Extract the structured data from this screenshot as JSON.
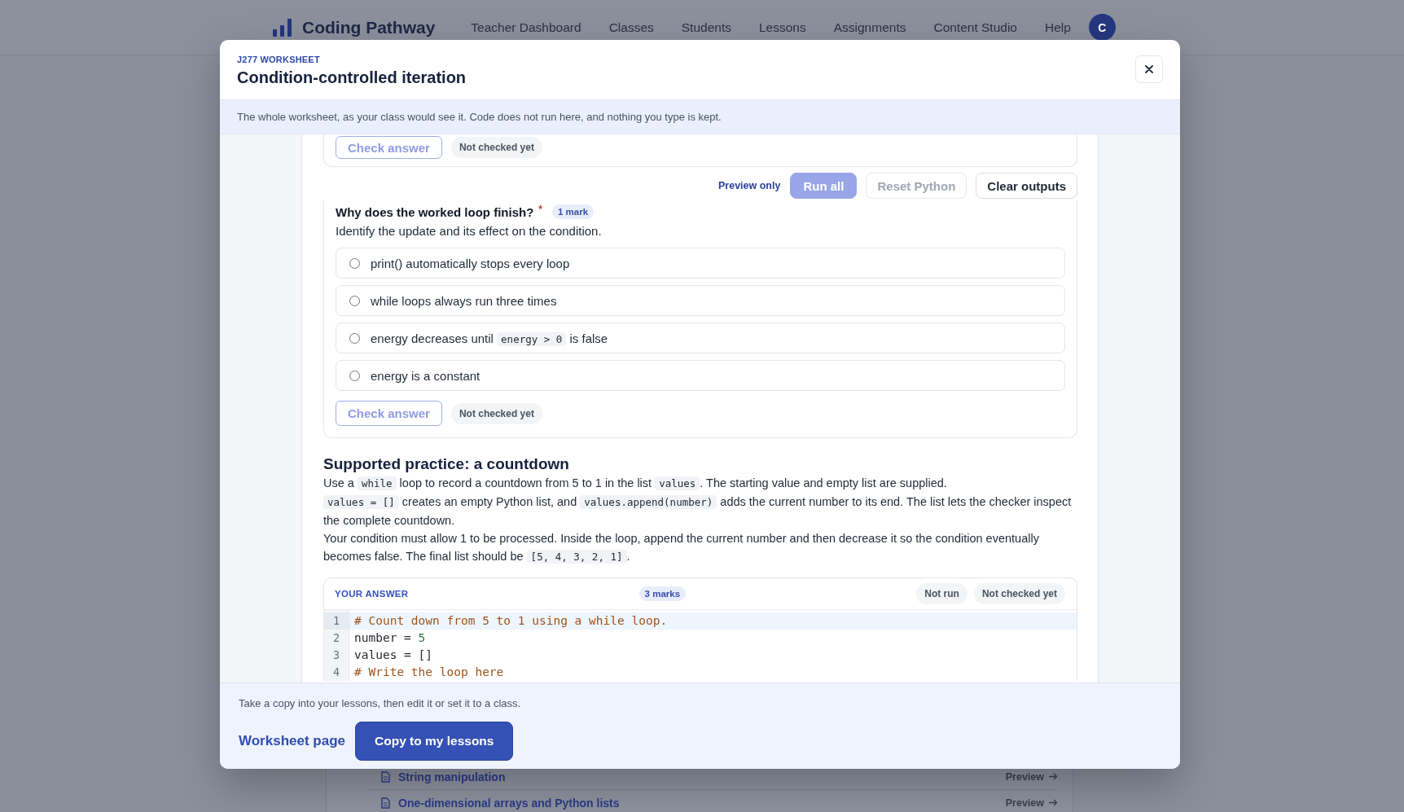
{
  "nav": {
    "brand": "Coding Pathway",
    "links": [
      {
        "label": "Teacher Dashboard"
      },
      {
        "label": "Classes"
      },
      {
        "label": "Students"
      },
      {
        "label": "Lessons"
      },
      {
        "label": "Assignments"
      },
      {
        "label": "Content Studio"
      },
      {
        "label": "Help"
      }
    ],
    "avatar": "C"
  },
  "modal": {
    "eyebrow": "J277 WORKSHEET",
    "title": "Condition-controlled iteration",
    "notice": "The whole worksheet, as your class would see it. Code does not run here, and nothing you type is kept.",
    "previous_question": {
      "check_button": {
        "label": "Check answer",
        "disabled": true
      },
      "status": "Not checked yet"
    },
    "toolbar": {
      "note": "Preview only",
      "buttons": [
        {
          "label": "Run all",
          "kind": "primary",
          "disabled": true
        },
        {
          "label": "Reset Python",
          "kind": "secondary",
          "disabled": true
        },
        {
          "label": "Clear outputs",
          "kind": "secondary",
          "disabled": false
        }
      ]
    },
    "question": {
      "title": "Why does the worked loop finish?",
      "required_mark": "*",
      "marks": "1 mark",
      "prompt": "Identify the update and its effect on the condition.",
      "options": [
        {
          "parts": [
            {
              "kind": "text",
              "text": "print() automatically stops every loop"
            }
          ],
          "selected": false
        },
        {
          "parts": [
            {
              "kind": "text",
              "text": "while loops always run three times"
            }
          ],
          "selected": false
        },
        {
          "parts": [
            {
              "kind": "text",
              "text": "energy decreases until "
            },
            {
              "kind": "code",
              "text": "energy > 0"
            },
            {
              "kind": "text",
              "text": " is false"
            }
          ],
          "selected": false
        },
        {
          "parts": [
            {
              "kind": "text",
              "text": "energy is a constant"
            }
          ],
          "selected": false
        }
      ],
      "check_button": {
        "label": "Check answer",
        "disabled": true
      },
      "status": "Not checked yet"
    },
    "practice": {
      "heading": "Supported practice: a countdown",
      "paragraphs": [
        [
          {
            "kind": "text",
            "text": "Use a "
          },
          {
            "kind": "code",
            "text": "while"
          },
          {
            "kind": "text",
            "text": " loop to record a countdown from 5 to 1 in the list "
          },
          {
            "kind": "code",
            "text": "values"
          },
          {
            "kind": "text",
            "text": ". The starting value and empty list are supplied."
          }
        ],
        [
          {
            "kind": "code",
            "text": "values = []"
          },
          {
            "kind": "text",
            "text": " creates an empty Python list, and "
          },
          {
            "kind": "code",
            "text": "values.append(number)"
          },
          {
            "kind": "text",
            "text": " adds the current number to its end. The list lets the checker inspect the complete countdown."
          }
        ],
        [
          {
            "kind": "text",
            "text": "Your condition must allow 1 to be processed. Inside the loop, append the current number and then decrease it so the condition eventually becomes false. The final list should be "
          },
          {
            "kind": "code",
            "text": "[5, 4, 3, 2, 1]"
          },
          {
            "kind": "text",
            "text": "."
          }
        ]
      ]
    },
    "answer": {
      "label": "YOUR ANSWER",
      "marks": "3 marks",
      "statuses": [
        "Not run",
        "Not checked yet"
      ],
      "lines": [
        {
          "number": "1",
          "active": true,
          "tokens": [
            {
              "kind": "comment",
              "text": "# Count down from 5 to 1 using a while loop."
            }
          ]
        },
        {
          "number": "2",
          "active": false,
          "tokens": [
            {
              "kind": "plain",
              "text": "number = "
            },
            {
              "kind": "number",
              "text": "5"
            }
          ]
        },
        {
          "number": "3",
          "active": false,
          "tokens": [
            {
              "kind": "plain",
              "text": "values = []"
            }
          ]
        },
        {
          "number": "4",
          "active": false,
          "tokens": [
            {
              "kind": "comment",
              "text": "# Write the loop here"
            }
          ]
        }
      ]
    },
    "footer": {
      "note": "Take a copy into your lessons, then edit it or set it to a class.",
      "link": "Worksheet page",
      "button": "Copy to my lessons"
    }
  },
  "background_list": {
    "rows": [
      {
        "title": "String manipulation",
        "link": "Preview"
      },
      {
        "title": "One-dimensional arrays and Python lists",
        "link": "Preview"
      }
    ]
  }
}
